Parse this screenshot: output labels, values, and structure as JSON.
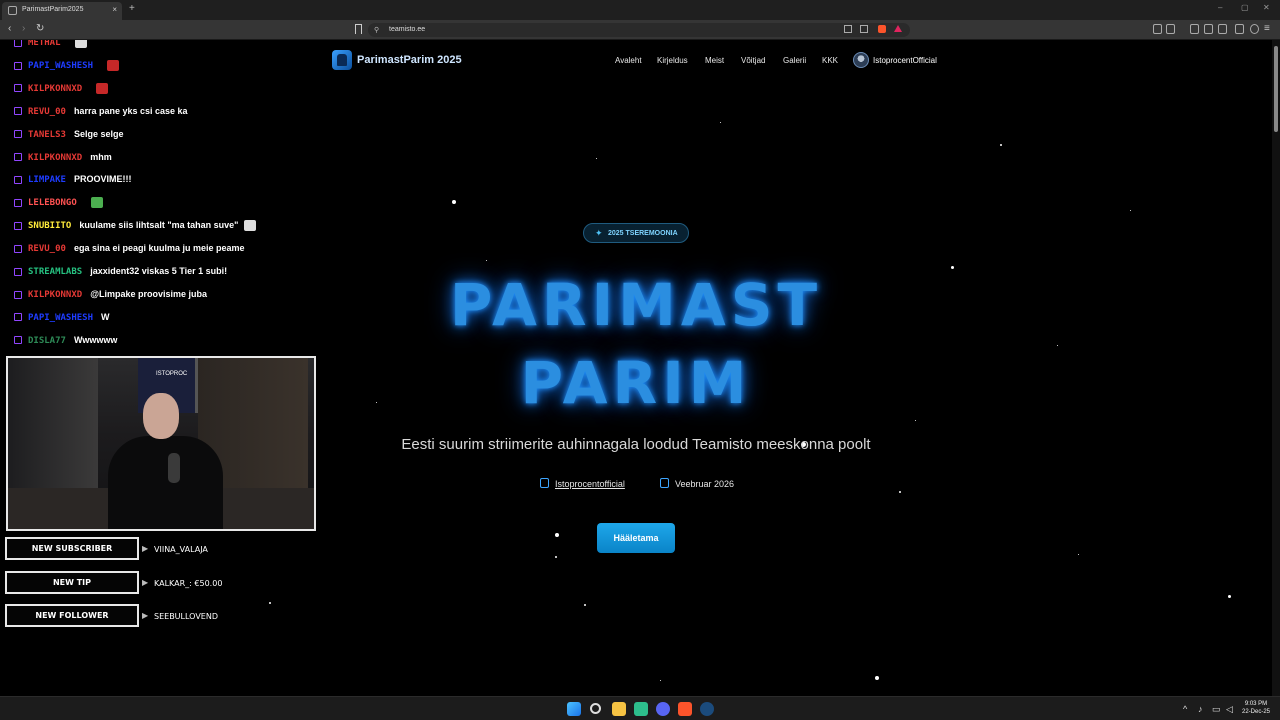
{
  "browser": {
    "tab_title": "ParimastParim2025",
    "tab_close": "×",
    "new_tab": "+",
    "url": "teamisto.ee",
    "window_controls": [
      "–",
      "▢",
      "✕"
    ]
  },
  "site": {
    "logo_name": "ParimastParim 2025",
    "nav": [
      "Avaleht",
      "Kirjeldus",
      "Meist",
      "Võitjad",
      "Galerii",
      "KKK"
    ],
    "user_name": "IstoprocentOfficial",
    "badge": "2025 TSEREMOONIA",
    "title_line1": "PARIMAST",
    "title_line2": "PARIM",
    "subtitle": "Eesti suurim striimerite auhinnagala loodud Teamisto meeskonna poolt",
    "twitch_link": "Istoprocentofficial",
    "date": "Veebruar 2026",
    "vote_button": "Hääletama"
  },
  "chat": [
    {
      "user": "METHAL",
      "message": "",
      "color": "#e53935",
      "emote": "#dddddd"
    },
    {
      "user": "PAPI_WASHESH",
      "message": "",
      "color": "#1e3cff",
      "emote": "#c62828"
    },
    {
      "user": "KILPKONNXD",
      "message": "",
      "color": "#e53935",
      "emote": "#c62828"
    },
    {
      "user": "REVU_00",
      "message": "harra pane yks csi case ka",
      "color": "#e53935"
    },
    {
      "user": "TANELS3",
      "message": "Selge selge",
      "color": "#e53935"
    },
    {
      "user": "KILPKONNXD",
      "message": "mhm",
      "color": "#e53935"
    },
    {
      "user": "LIMPAKE",
      "message": "PROOVIME!!!",
      "color": "#1e3cff"
    },
    {
      "user": "LELEBONGO",
      "message": "",
      "color": "#ff5252",
      "emote": "#4caf50"
    },
    {
      "user": "SNUBIITO",
      "message": "kuulame siis lihtsalt \"ma tahan suve\"",
      "color": "#ffeb3b",
      "emote": "#dddddd"
    },
    {
      "user": "REVU_00",
      "message": "ega sina ei peagi kuulma ju meie peame",
      "color": "#e53935"
    },
    {
      "user": "STREAMLABS",
      "message": "jaxxident32 viskas 5 Tier 1 subi!",
      "color": "#26c281"
    },
    {
      "user": "KILPKONNXD",
      "message": "@Limpake proovisime juba",
      "color": "#e53935"
    },
    {
      "user": "PAPI_WASHESH",
      "message": "W",
      "color": "#1e3cff"
    },
    {
      "user": "DISLA77",
      "message": "Wwwwww",
      "color": "#2e8b57"
    }
  ],
  "webcam": {
    "label": "ISTOPROC"
  },
  "alerts": [
    {
      "label": "NEW SUBSCRIBER",
      "name": "VIINA_VALAJA"
    },
    {
      "label": "NEW TIP",
      "name": "KALKAR_: €50.00"
    },
    {
      "label": "NEW FOLLOWER",
      "name": "SEEBULLOVEND"
    }
  ],
  "taskbar": {
    "time": "9:03 PM",
    "date": "22-Dec-25"
  },
  "colors": {
    "accent": "#1ea7ea",
    "title_glow": "#1e90ff",
    "twitch": "#9146ff"
  }
}
